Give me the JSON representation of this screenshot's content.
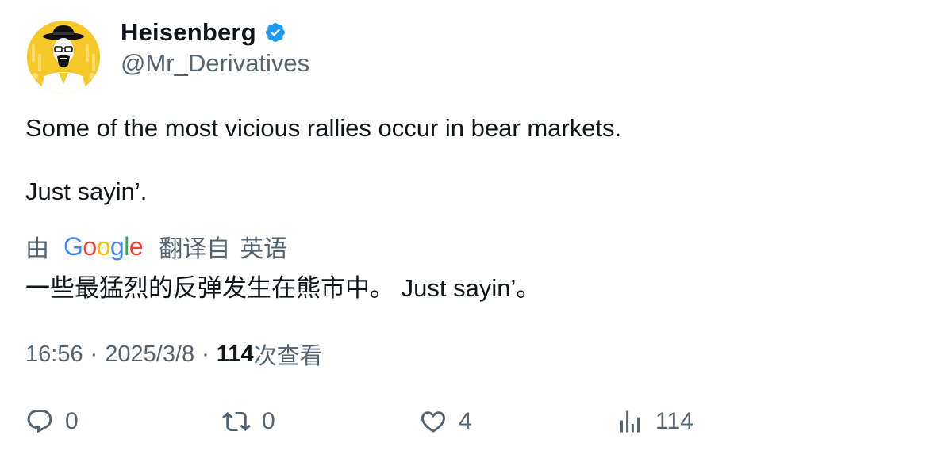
{
  "author": {
    "display_name": "Heisenberg",
    "handle": "@Mr_Derivatives",
    "verified_icon": "verified-badge-icon",
    "avatar_icon": "heisenberg-avatar-icon"
  },
  "tweet": {
    "text_line1": "Some of the most vicious rallies occur in bear markets.",
    "text_line2": "Just sayin’."
  },
  "translation": {
    "by_label": "由",
    "provider": "Google",
    "translated_label": "翻译自",
    "language": "英语",
    "translated_text": "一些最猛烈的反弹发生在熊市中。 Just sayin’。"
  },
  "meta": {
    "time": "16:56",
    "separator": "·",
    "date": "2025/3/8",
    "views_count": "114",
    "views_label": "次查看"
  },
  "actions": {
    "reply_count": "0",
    "retweet_count": "0",
    "like_count": "4",
    "views_count": "114"
  },
  "colors": {
    "primary_text": "#0f1419",
    "secondary_text": "#536471",
    "verified_blue": "#1d9bf0",
    "avatar_bg": "#f6c92a"
  }
}
